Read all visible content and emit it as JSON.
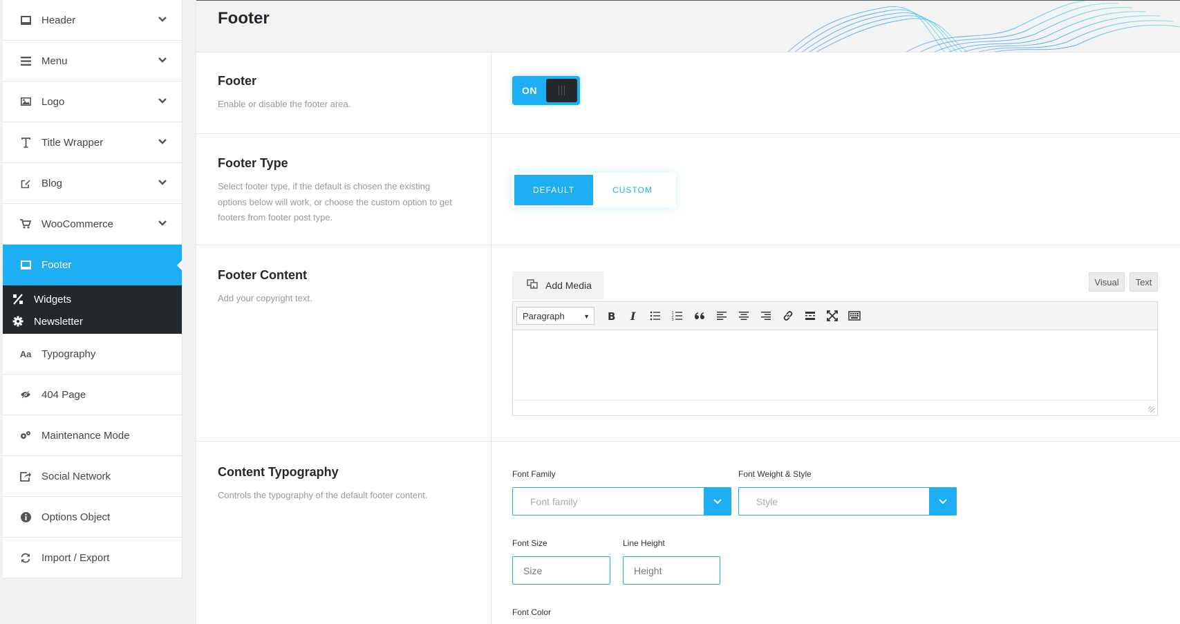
{
  "sidebar": {
    "items": [
      {
        "label": "Header",
        "icon": "monitor-icon"
      },
      {
        "label": "Menu",
        "icon": "hamburger-icon"
      },
      {
        "label": "Logo",
        "icon": "image-icon"
      },
      {
        "label": "Title Wrapper",
        "icon": "text-cursor-icon"
      },
      {
        "label": "Blog",
        "icon": "edit-icon"
      },
      {
        "label": "WooCommerce",
        "icon": "cart-icon"
      },
      {
        "label": "Footer",
        "icon": "monitor-icon"
      }
    ],
    "submenu": [
      {
        "label": "Widgets",
        "icon": "widgets-icon"
      },
      {
        "label": "Newsletter",
        "icon": "gear-icon"
      }
    ],
    "items_after": [
      {
        "label": "Typography",
        "icon": "font-icon"
      },
      {
        "label": "404 Page",
        "icon": "eye-slash-icon"
      },
      {
        "label": "Maintenance Mode",
        "icon": "cogs-icon"
      },
      {
        "label": "Social Network",
        "icon": "share-icon"
      },
      {
        "label": "Options Object",
        "icon": "info-icon"
      },
      {
        "label": "Import / Export",
        "icon": "refresh-icon"
      }
    ]
  },
  "page": {
    "title": "Footer"
  },
  "footer_toggle": {
    "title": "Footer",
    "description": "Enable or disable the footer area.",
    "state_label": "ON"
  },
  "footer_type": {
    "title": "Footer Type",
    "description": "Select footer type, if the default is chosen the existing options below will work, or choose the custom option to get footers from footer post type.",
    "options": [
      "DEFAULT",
      "CUSTOM"
    ],
    "selected": "DEFAULT"
  },
  "footer_content": {
    "title": "Footer Content",
    "description": "Add your copyright text.",
    "add_media_label": "Add Media",
    "tab_visual": "Visual",
    "tab_text": "Text",
    "format_value": "Paragraph"
  },
  "content_typography": {
    "title": "Content Typography",
    "description": "Controls the typography of the default footer content.",
    "font_family_label": "Font Family",
    "font_family_placeholder": "Font family",
    "font_weight_label": "Font Weight & Style",
    "font_weight_placeholder": "Style",
    "font_size_label": "Font Size",
    "font_size_placeholder": "Size",
    "line_height_label": "Line Height",
    "line_height_placeholder": "Height",
    "font_color_label": "Font Color"
  },
  "colors": {
    "accent": "#1eaef3",
    "dark": "#23282d"
  }
}
